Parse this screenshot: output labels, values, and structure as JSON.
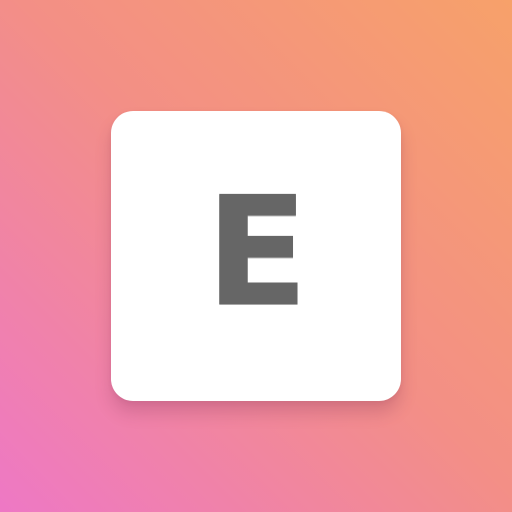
{
  "icon": {
    "letter": "E",
    "colors": {
      "gradient_start": "#f7a16a",
      "gradient_mid": "#f38f86",
      "gradient_end": "#ee78c5",
      "tile": "#ffffff",
      "letter": "#666666"
    }
  }
}
